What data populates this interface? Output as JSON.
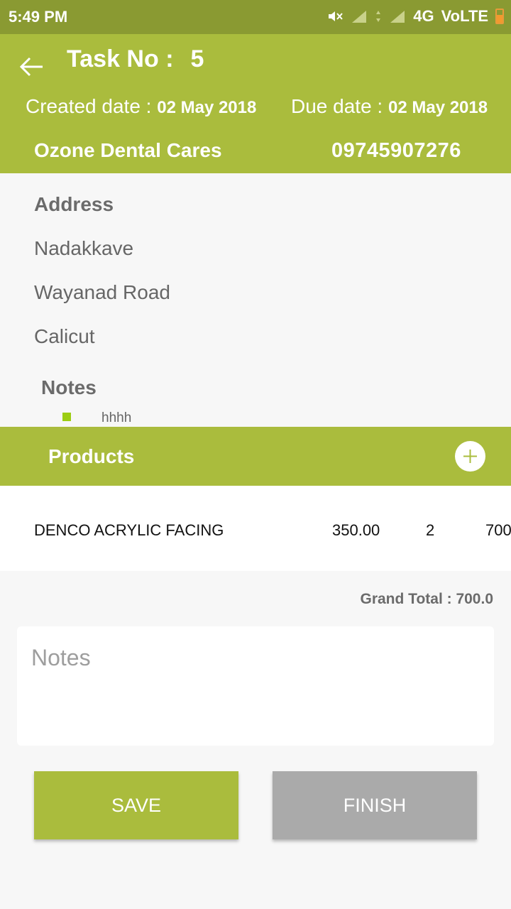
{
  "status_bar": {
    "time": "5:49 PM",
    "network": "4G",
    "volte": "VoLTE",
    "icons": [
      "mute-icon",
      "signal-icon",
      "data-arrows-icon",
      "signal-icon",
      "battery-icon"
    ]
  },
  "header": {
    "task_label": "Task No :",
    "task_number": "5",
    "created_label": "Created date :",
    "created_value": "02 May 2018",
    "due_label": "Due date :",
    "due_value": "02 May 2018",
    "company": "Ozone Dental Cares",
    "phone": "09745907276"
  },
  "address": {
    "label": "Address",
    "lines": [
      "Nadakkave",
      "Wayanad Road",
      "Calicut"
    ]
  },
  "notes": {
    "label": "Notes",
    "items": [
      "hhhh"
    ]
  },
  "products": {
    "title": "Products",
    "rows": [
      {
        "name": "DENCO ACRYLIC FACING",
        "price": "350.00",
        "qty": "2",
        "total": "700"
      }
    ]
  },
  "grand_total": "Grand Total : 700.0",
  "notes_input": {
    "placeholder": "Notes",
    "value": ""
  },
  "buttons": {
    "save": "SAVE",
    "finish": "FINISH"
  },
  "colors": {
    "primary": "#aabc3d",
    "status_bar": "#8a9a32",
    "bullet": "#9ccd13",
    "disabled_button": "#aaaaaa"
  }
}
